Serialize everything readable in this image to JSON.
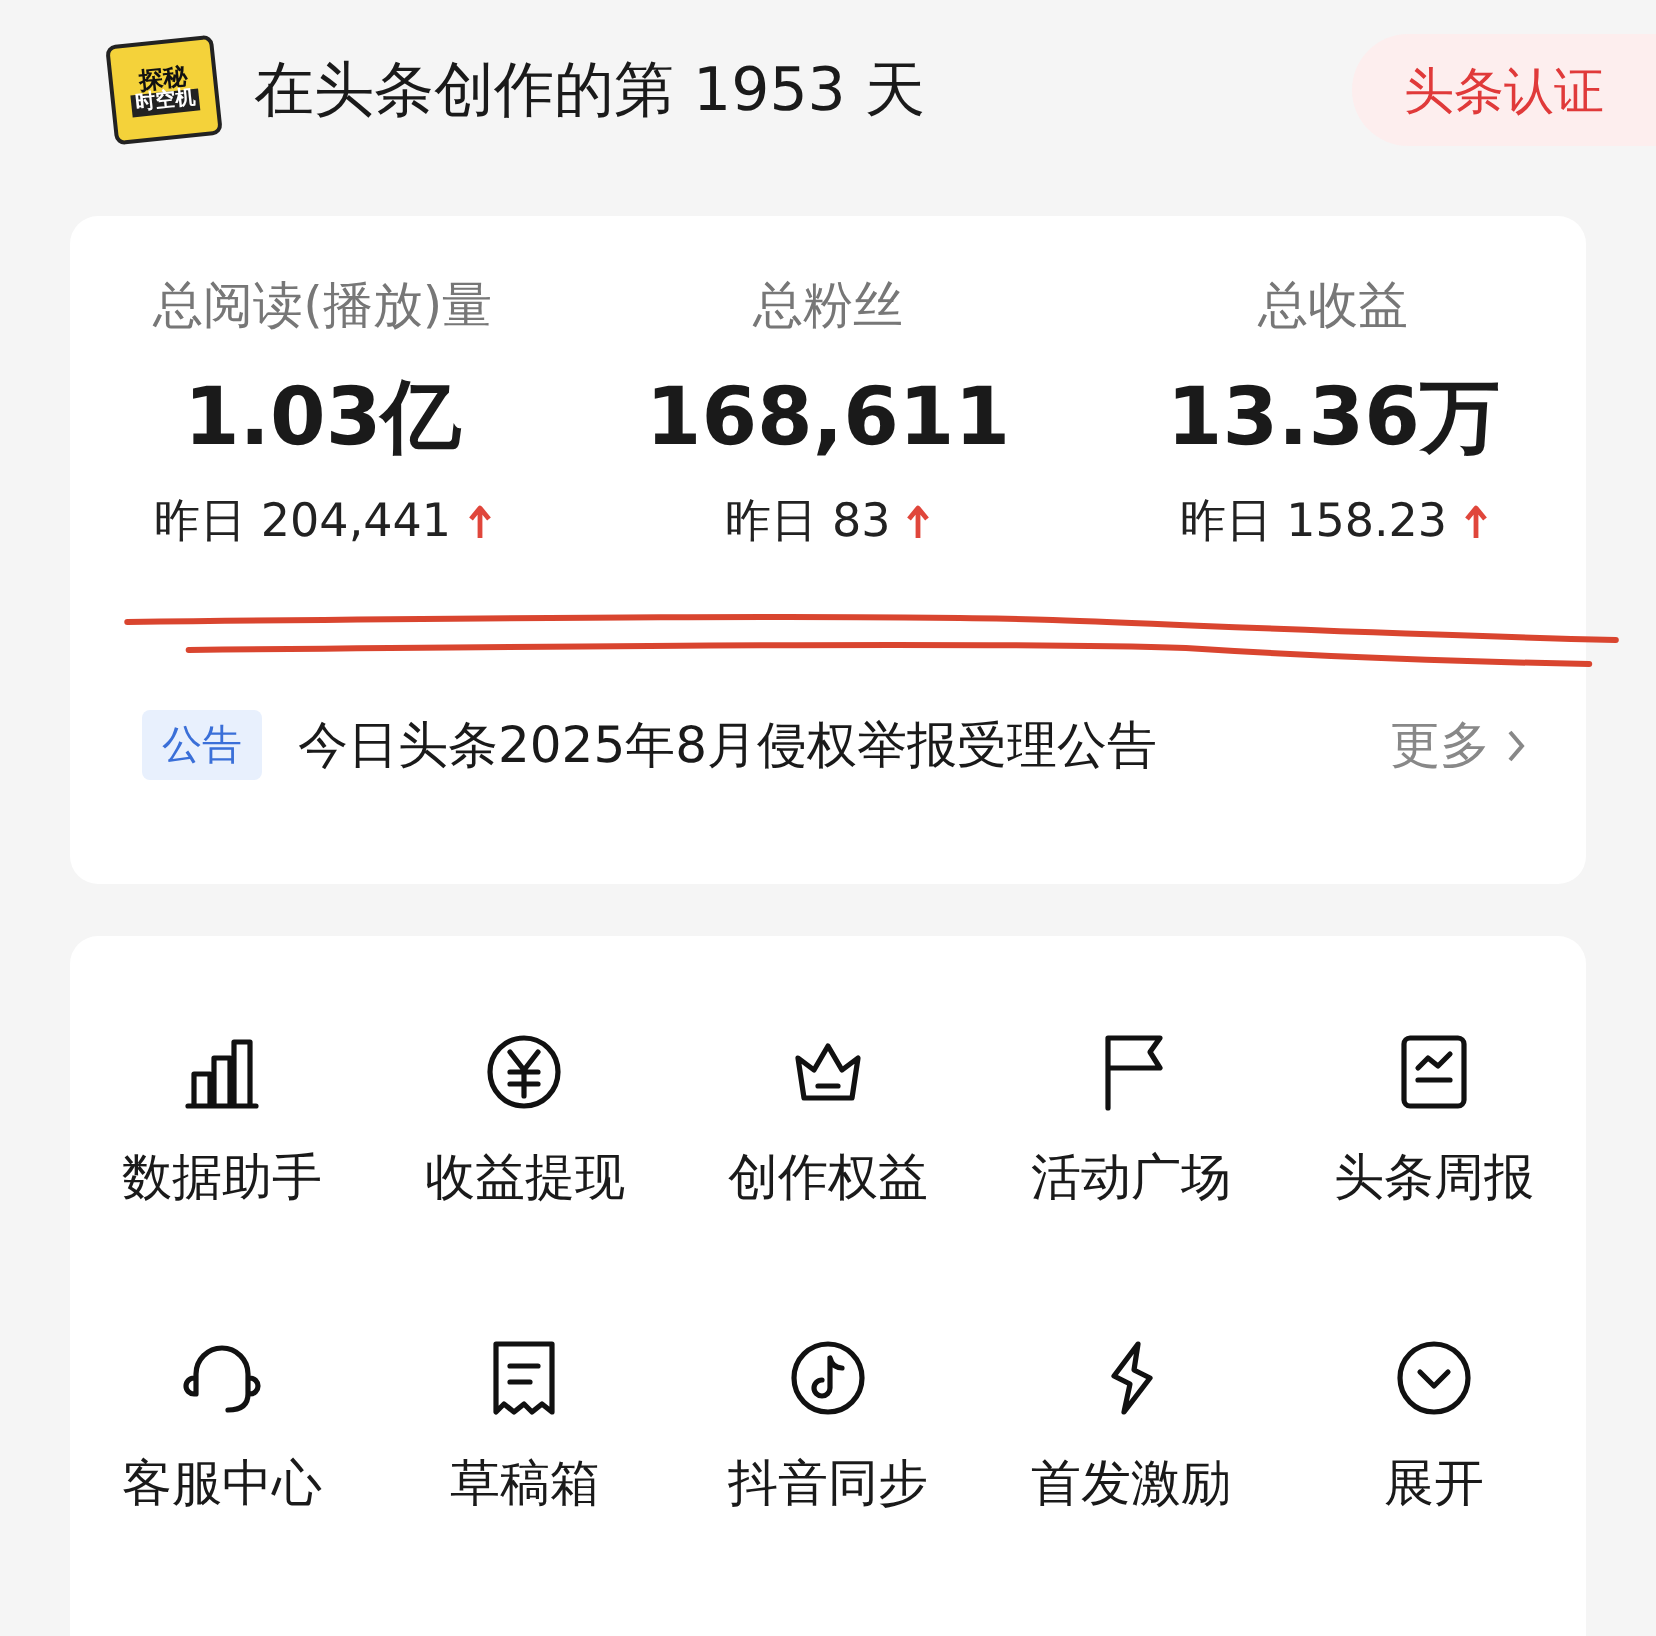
{
  "header": {
    "logo": [
      "探秘",
      "时空机"
    ],
    "title": "在头条创作的第 1953 天",
    "badge": "头条认证"
  },
  "stats": [
    {
      "label": "总阅读(播放)量",
      "value": "1.03亿",
      "yesterday": "昨日 204,441",
      "rising": true
    },
    {
      "label": "总粉丝",
      "value": "168,611",
      "yesterday": "昨日 83",
      "rising": true
    },
    {
      "label": "总收益",
      "value": "13.36万",
      "yesterday": "昨日 158.23",
      "rising": true
    }
  ],
  "notice": {
    "tag": "公告",
    "text": "今日头条2025年8月侵权举报受理公告",
    "more": "更多"
  },
  "tools": [
    {
      "label": "数据助手"
    },
    {
      "label": "收益提现"
    },
    {
      "label": "创作权益"
    },
    {
      "label": "活动广场"
    },
    {
      "label": "头条周报"
    },
    {
      "label": "客服中心"
    },
    {
      "label": "草稿箱"
    },
    {
      "label": "抖音同步"
    },
    {
      "label": "首发激励"
    },
    {
      "label": "展开"
    }
  ]
}
